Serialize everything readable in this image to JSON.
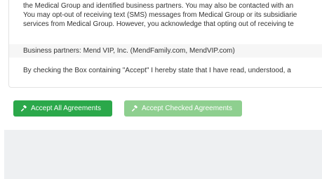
{
  "agreement": {
    "paragraph_lines": [
      "the Medical Group and identified business partners. You may also be contacted with an",
      "You may opt-out of receiving text (SMS) messages from Medical Group or its subsidiarie",
      "services from Medical Group. However, you acknowledge that opting out of receiving te"
    ],
    "business_partners": "Business partners: Mend VIP, Inc. (MendFamily.com, MendVIP.com)",
    "consent_statement": "By checking the Box containing \"Accept\" I hereby state that I have read, understood, a"
  },
  "actions": {
    "accept_all_label": "Accept All Agreements",
    "accept_checked_label": "Accept Checked Agreements",
    "icon": "gavel-icon"
  },
  "colors": {
    "accept_all_bg": "#2ba84a",
    "accept_checked_bg": "#8ecf8f",
    "footer_bg": "#eef0f2"
  }
}
